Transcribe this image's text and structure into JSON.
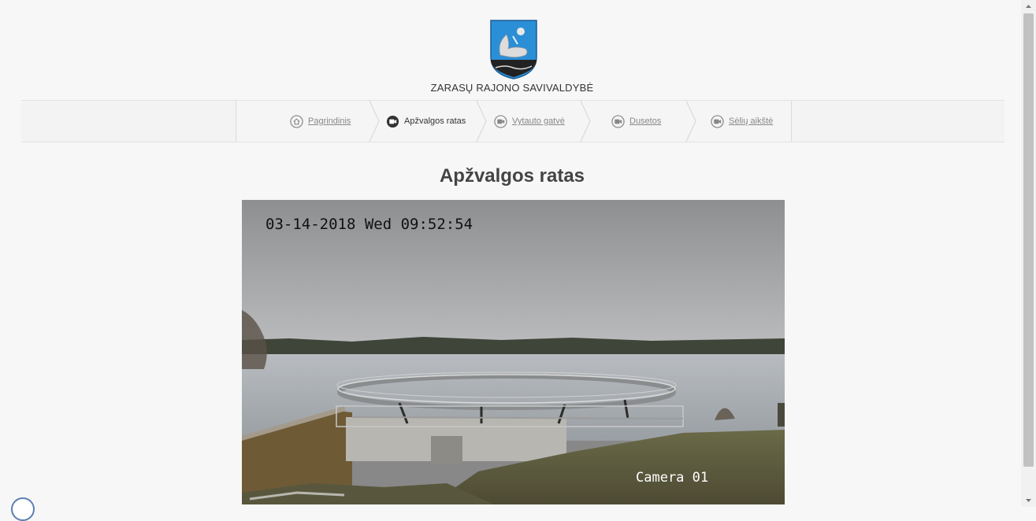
{
  "header": {
    "org_name": "ZARASŲ RAJONO SAVIVALDYBĖ",
    "crest_icon": "zarasai-coat-of-arms-icon"
  },
  "nav": {
    "items": [
      {
        "label": "Pagrindinis",
        "icon": "home-icon",
        "active": false
      },
      {
        "label": "Apžvalgos ratas",
        "icon": "camera-icon",
        "active": true
      },
      {
        "label": "Vytauto gatvė",
        "icon": "camera-icon",
        "active": false
      },
      {
        "label": "Dusetos",
        "icon": "camera-icon",
        "active": false
      },
      {
        "label": "Sėlių aikštė",
        "icon": "camera-icon",
        "active": false
      }
    ]
  },
  "main": {
    "title": "Apžvalgos ratas",
    "camera": {
      "timestamp": "03-14-2018 Wed 09:52:54",
      "label": "Camera 01"
    }
  },
  "colors": {
    "page_bg": "#f7f7f7",
    "nav_bg": "#f3f3f3",
    "crest_blue": "#2a8fd6"
  }
}
